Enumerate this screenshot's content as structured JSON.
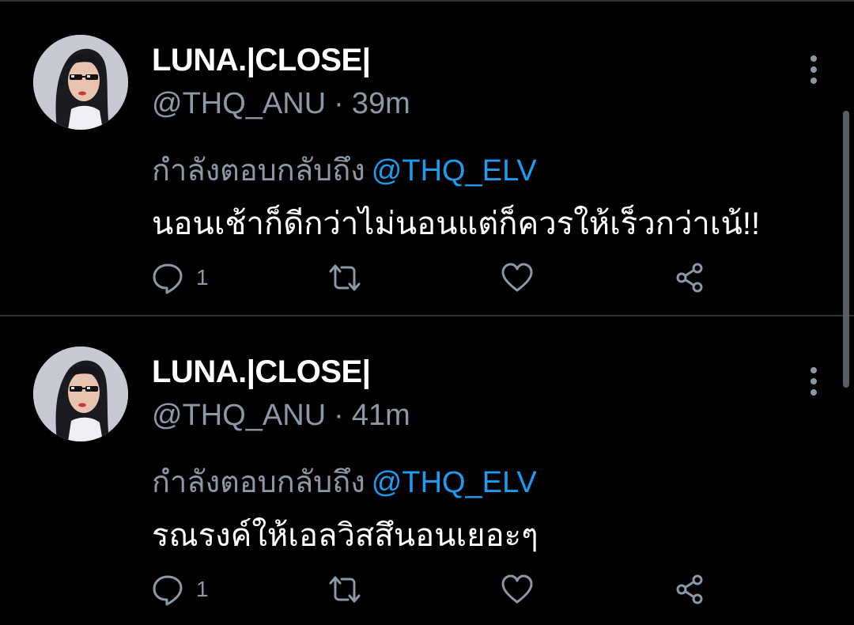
{
  "tweets": [
    {
      "display_name": "LUNA.|CLOSE|",
      "handle": "@THQ_ANU",
      "separator": "·",
      "time": "39m",
      "reply_prefix": "กำลังตอบกลับถึง",
      "reply_mention": "@THQ_ELV",
      "text": "นอนเช้าก็ดีกว่าไม่นอนแต่ก็ควรให้เร็วกว่าเน้!!",
      "reply_count": "1",
      "icons": {
        "more": "more-vertical-icon",
        "reply": "comment-icon",
        "retweet": "retweet-icon",
        "like": "heart-icon",
        "share": "share-icon"
      }
    },
    {
      "display_name": "LUNA.|CLOSE|",
      "handle": "@THQ_ANU",
      "separator": "·",
      "time": "41m",
      "reply_prefix": "กำลังตอบกลับถึง",
      "reply_mention": "@THQ_ELV",
      "text": "รณรงค์ให้เอลวิสสึนอนเยอะๆ",
      "reply_count": "1",
      "icons": {
        "more": "more-vertical-icon",
        "reply": "comment-icon",
        "retweet": "retweet-icon",
        "like": "heart-icon",
        "share": "share-icon"
      }
    }
  ],
  "colors": {
    "background": "#000000",
    "primary_text": "#ffffff",
    "secondary_text": "#8b98a5",
    "mention": "#1d9bf0",
    "divider": "#2f3336"
  }
}
